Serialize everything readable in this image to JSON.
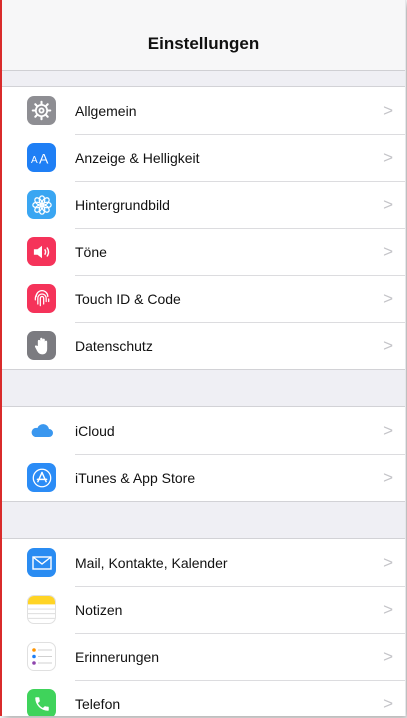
{
  "navbar": {
    "title": "Einstellungen"
  },
  "groups": [
    {
      "items": [
        {
          "label": "Allgemein",
          "icon": "gear-icon",
          "color": "#8e8e93"
        },
        {
          "label": "Anzeige & Helligkeit",
          "icon": "text-size-icon",
          "color": "#1f7ff5"
        },
        {
          "label": "Hintergrundbild",
          "icon": "wallpaper-flower-icon",
          "color": "#3aa6f2"
        },
        {
          "label": "Töne",
          "icon": "speaker-icon",
          "color": "#f5335a"
        },
        {
          "label": "Touch ID & Code",
          "icon": "fingerprint-icon",
          "color": "#f5335a"
        },
        {
          "label": "Datenschutz",
          "icon": "hand-icon",
          "color": "#7b7b80"
        }
      ]
    },
    {
      "items": [
        {
          "label": "iCloud",
          "icon": "cloud-icon",
          "color": "#ffffff"
        },
        {
          "label": "iTunes & App Store",
          "icon": "app-store-icon",
          "color": "#2b8cf6"
        }
      ]
    },
    {
      "items": [
        {
          "label": "Mail, Kontakte, Kalender",
          "icon": "mail-icon",
          "color": "#2a8cf2"
        },
        {
          "label": "Notizen",
          "icon": "notes-icon",
          "color": "#ffd425"
        },
        {
          "label": "Erinnerungen",
          "icon": "reminders-icon",
          "color": "#ffffff"
        },
        {
          "label": "Telefon",
          "icon": "phone-icon",
          "color": "#3fd35b"
        }
      ]
    }
  ],
  "chevron_glyph": ">"
}
